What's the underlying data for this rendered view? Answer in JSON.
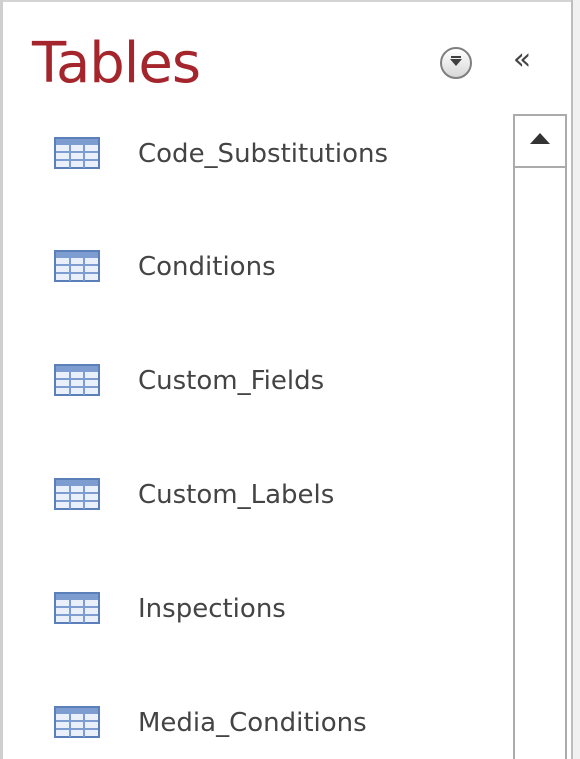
{
  "pane": {
    "title": "Tables",
    "dropdown_icon": "chevron-down-circle-icon",
    "collapse_label": "«",
    "accent_color": "#a4262c"
  },
  "tables": [
    {
      "label": "Code_Substitutions",
      "icon": "table-icon"
    },
    {
      "label": "Conditions",
      "icon": "table-icon"
    },
    {
      "label": "Custom_Fields",
      "icon": "table-icon"
    },
    {
      "label": "Custom_Labels",
      "icon": "table-icon"
    },
    {
      "label": "Inspections",
      "icon": "table-icon"
    },
    {
      "label": "Media_Conditions",
      "icon": "table-icon"
    }
  ]
}
